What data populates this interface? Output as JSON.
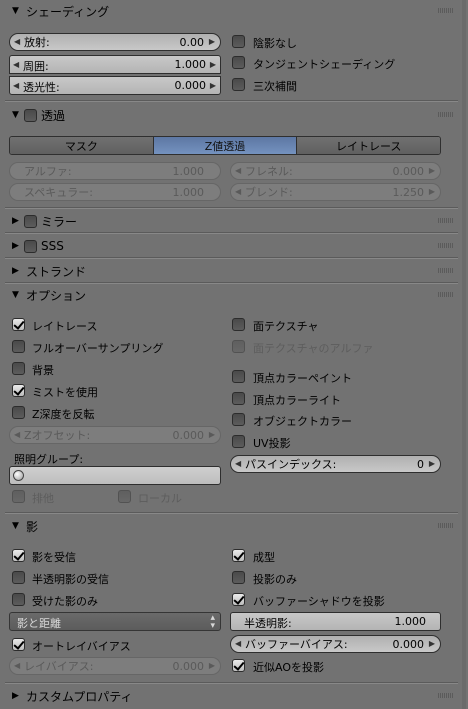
{
  "shading": {
    "title": "シェーディング",
    "emit": {
      "label": "放射:",
      "value": "0.00"
    },
    "ambient": {
      "label": "周囲:",
      "value": "1.000"
    },
    "translucency": {
      "label": "透光性:",
      "value": "0.000"
    },
    "shadeless": "陰影なし",
    "tangent": "タンジェントシェーディング",
    "cubic": "三次補間"
  },
  "transparency": {
    "title": "透過",
    "tabs": [
      "マスク",
      "Z値透過",
      "レイトレース"
    ],
    "alpha": {
      "label": "アルファ:",
      "value": "1.000"
    },
    "fresnel": {
      "label": "フレネル:",
      "value": "0.000"
    },
    "specular": {
      "label": "スペキュラー:",
      "value": "1.000"
    },
    "blend": {
      "label": "ブレンド:",
      "value": "1.250"
    }
  },
  "mirror": {
    "title": "ミラー"
  },
  "sss": {
    "title": "SSS"
  },
  "strand": {
    "title": "ストランド"
  },
  "options": {
    "title": "オプション",
    "raytrace": "レイトレース",
    "full_oversampling": "フルオーバーサンプリング",
    "sky": "背景",
    "use_mist": "ミストを使用",
    "invert_z": "Z深度を反転",
    "z_offset": {
      "label": "Zオフセット:",
      "value": "0.000"
    },
    "light_group_label": "照明グループ:",
    "exclusive": "排他",
    "local": "ローカル",
    "face_texture": "面テクスチャ",
    "face_texture_alpha": "面テクスチャのアルファ",
    "vertex_color_paint": "頂点カラーペイント",
    "vertex_color_light": "頂点カラーライト",
    "object_color": "オブジェクトカラー",
    "uv_project": "UV投影",
    "pass_index": {
      "label": "パスインデックス:",
      "value": "0"
    }
  },
  "shadow": {
    "title": "影",
    "receive": "影を受信",
    "receive_transparent": "半透明影の受信",
    "only": "受けた影のみ",
    "shadow_select": "影と距離",
    "auto_bias": "オートレイバイアス",
    "ray_bias": {
      "label": "レイバイアス:",
      "value": "0.000"
    },
    "cast": "成型",
    "cast_only": "投影のみ",
    "cast_buffer": "バッファーシャドウを投影",
    "translucency": {
      "label": "半透明影:",
      "value": "1.000"
    },
    "buffer_bias": {
      "label": "バッファーバイアス:",
      "value": "0.000"
    },
    "cast_approx": "近似AOを投影"
  },
  "custom": {
    "title": "カスタムプロパティ"
  }
}
